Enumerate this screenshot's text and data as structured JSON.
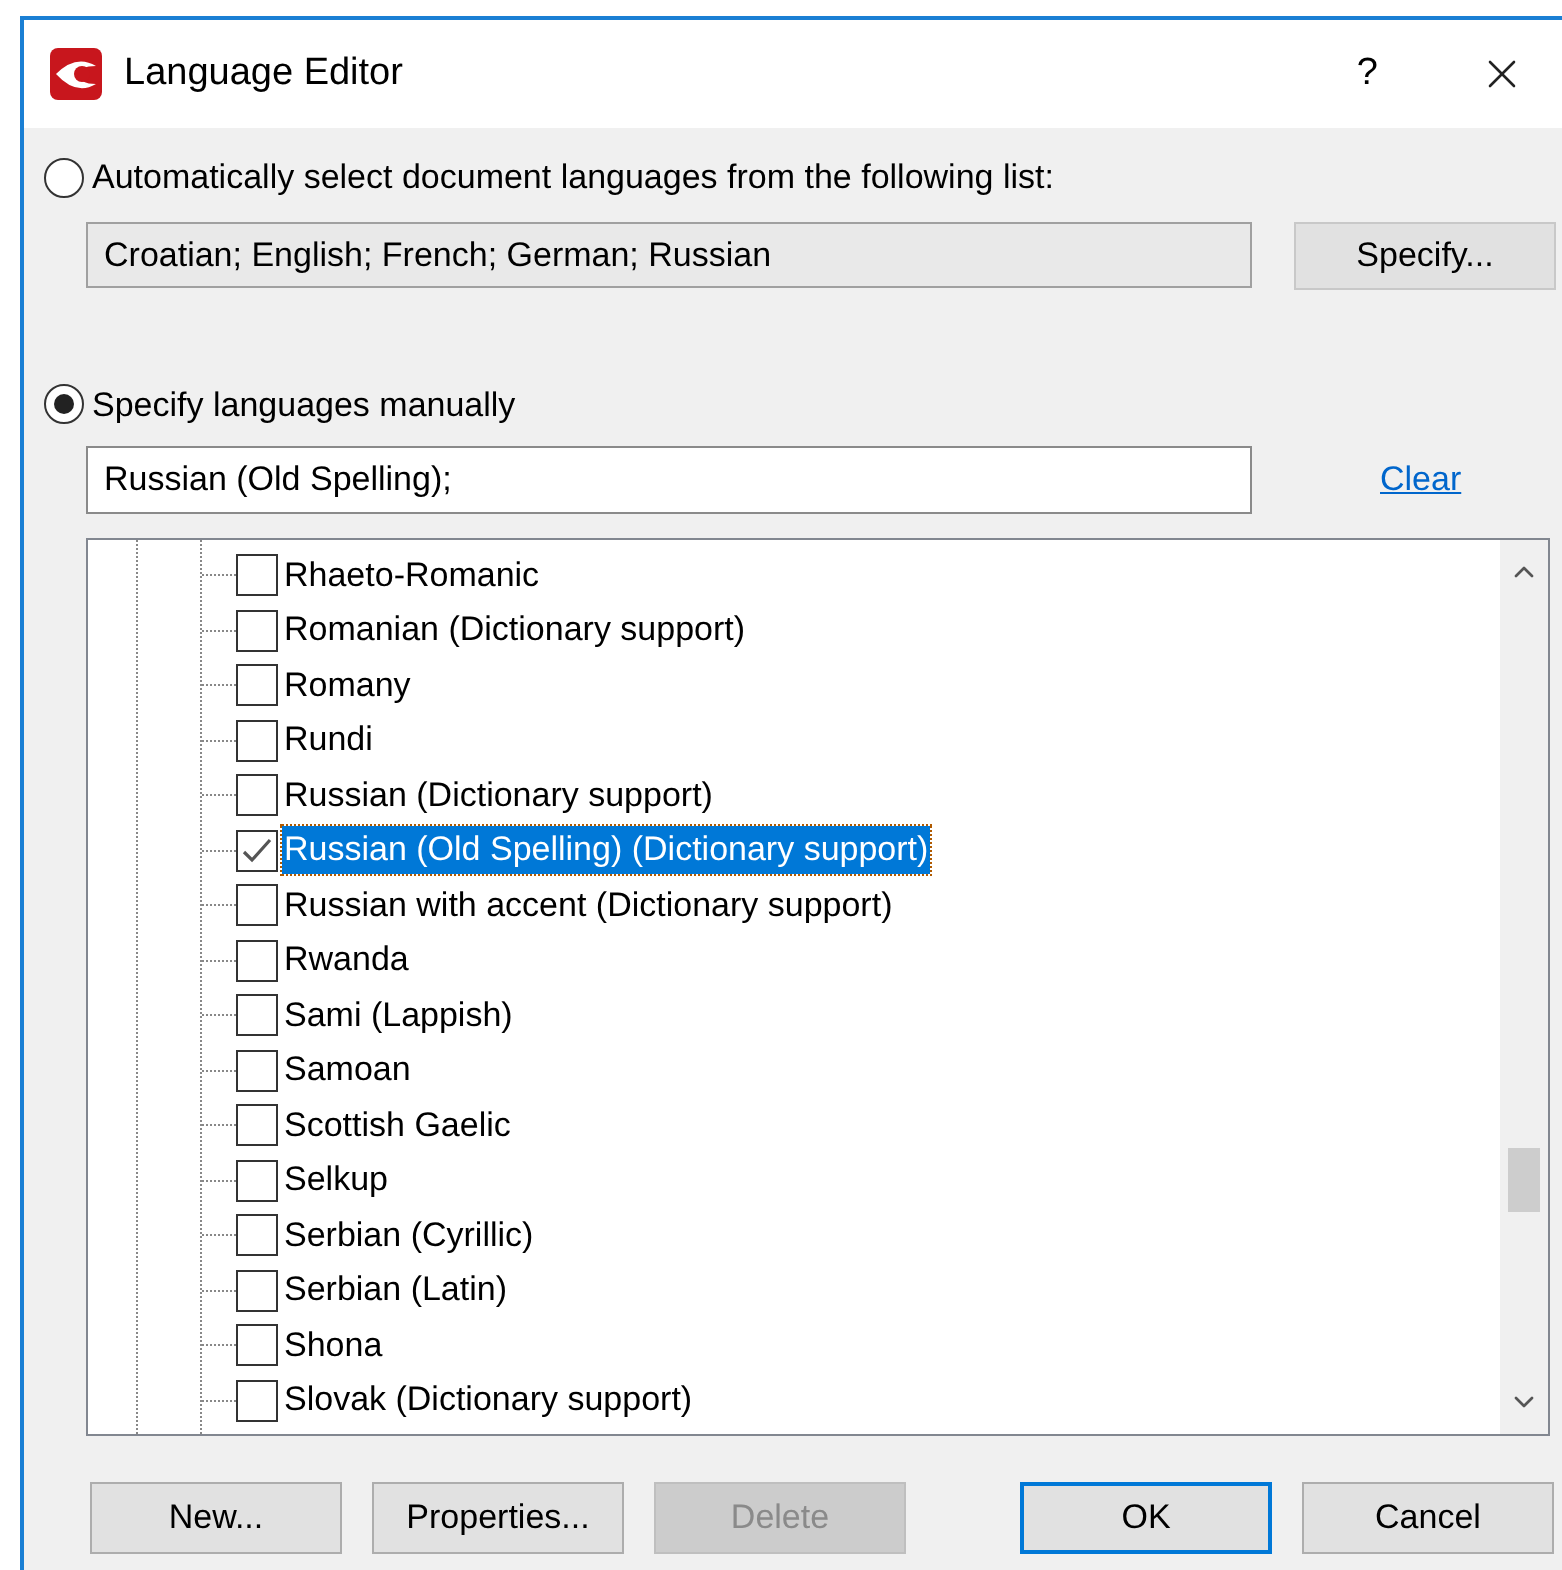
{
  "window": {
    "title": "Language Editor",
    "help": "?"
  },
  "auto_option": {
    "label": "Automatically select document languages from the following list:",
    "selected": false,
    "value": "Croatian; English; French; German; Russian",
    "button": "Specify..."
  },
  "manual_option": {
    "label": "Specify languages manually",
    "selected": true,
    "value": "Russian (Old Spelling);",
    "link": "Clear"
  },
  "languages": [
    {
      "label": "Rhaeto-Romanic",
      "checked": false,
      "selected": false
    },
    {
      "label": "Romanian (Dictionary support)",
      "checked": false,
      "selected": false
    },
    {
      "label": "Romany",
      "checked": false,
      "selected": false
    },
    {
      "label": "Rundi",
      "checked": false,
      "selected": false
    },
    {
      "label": "Russian (Dictionary support)",
      "checked": false,
      "selected": false
    },
    {
      "label": "Russian (Old Spelling) (Dictionary support)",
      "checked": true,
      "selected": true
    },
    {
      "label": "Russian with accent (Dictionary support)",
      "checked": false,
      "selected": false
    },
    {
      "label": "Rwanda",
      "checked": false,
      "selected": false
    },
    {
      "label": "Sami (Lappish)",
      "checked": false,
      "selected": false
    },
    {
      "label": "Samoan",
      "checked": false,
      "selected": false
    },
    {
      "label": "Scottish Gaelic",
      "checked": false,
      "selected": false
    },
    {
      "label": "Selkup",
      "checked": false,
      "selected": false
    },
    {
      "label": "Serbian (Cyrillic)",
      "checked": false,
      "selected": false
    },
    {
      "label": "Serbian (Latin)",
      "checked": false,
      "selected": false
    },
    {
      "label": "Shona",
      "checked": false,
      "selected": false
    },
    {
      "label": "Slovak (Dictionary support)",
      "checked": false,
      "selected": false
    }
  ],
  "buttons": [
    {
      "label": "New...",
      "disabled": false,
      "default": false
    },
    {
      "label": "Properties...",
      "disabled": false,
      "default": false
    },
    {
      "label": "Delete",
      "disabled": true,
      "default": false
    },
    {
      "label": "OK",
      "disabled": false,
      "default": true
    },
    {
      "label": "Cancel",
      "disabled": false,
      "default": false
    }
  ]
}
